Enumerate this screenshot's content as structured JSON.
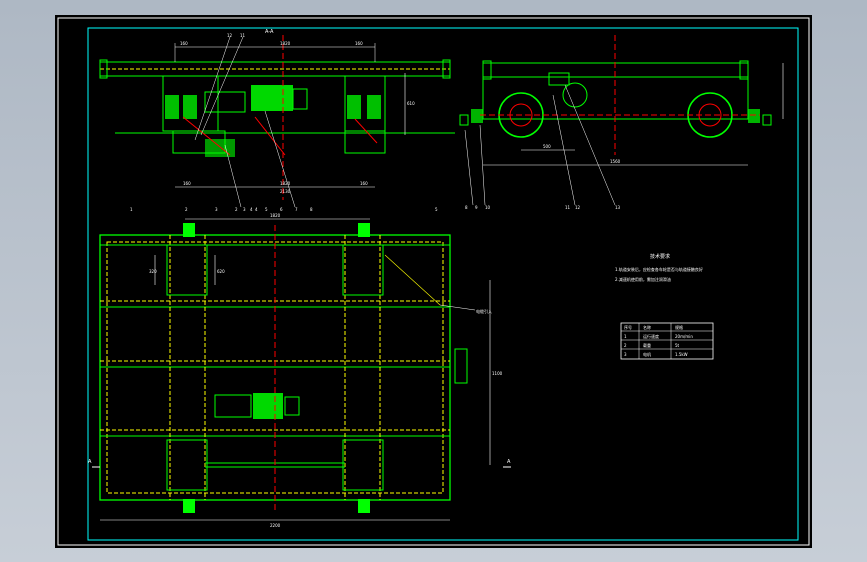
{
  "drawing": {
    "section_label": "A-A",
    "dims_front_top": [
      "160",
      "1820",
      "160"
    ],
    "dims_front_bottom": [
      "160",
      "1820",
      "160"
    ],
    "dim_front_bottom_total": "2130",
    "dim_front_height": "610",
    "dim_side_wheelbase": "500",
    "dim_side_total": "1560",
    "dim_plan_top": "1820",
    "dim_plan_bottom": "2200",
    "dim_plan_left_a": "320",
    "dim_plan_left_b": "620",
    "dim_plan_right": "1100",
    "balloons_front": [
      "11",
      "12",
      "2",
      "3",
      "4",
      "5",
      "6",
      "7",
      "8"
    ],
    "balloons_side": [
      "8",
      "9",
      "10",
      "11",
      "12",
      "13"
    ],
    "balloons_plan": [
      "1",
      "2",
      "3",
      "4",
      "5"
    ],
    "section_marks": [
      "A",
      "A"
    ],
    "callout_label": "电缆引入",
    "tech_title": "技术要求",
    "tech_lines": [
      "1.轨道安装后，应检查各车轮是否与轨道接触良好",
      "2.减速机使用前，需加注润滑油"
    ],
    "table_header": [
      "序号",
      "名称",
      "规格"
    ],
    "table_rows": [
      [
        "1",
        "运行速度",
        "20m/min"
      ],
      [
        "2",
        "载重",
        "5t"
      ],
      [
        "3",
        "电机",
        "1.5kW"
      ]
    ]
  },
  "colors": {
    "line": "#00ff00",
    "dash": "#ffff00",
    "center": "#ff0000",
    "dim": "#ffffff",
    "border": "#00ffff"
  }
}
